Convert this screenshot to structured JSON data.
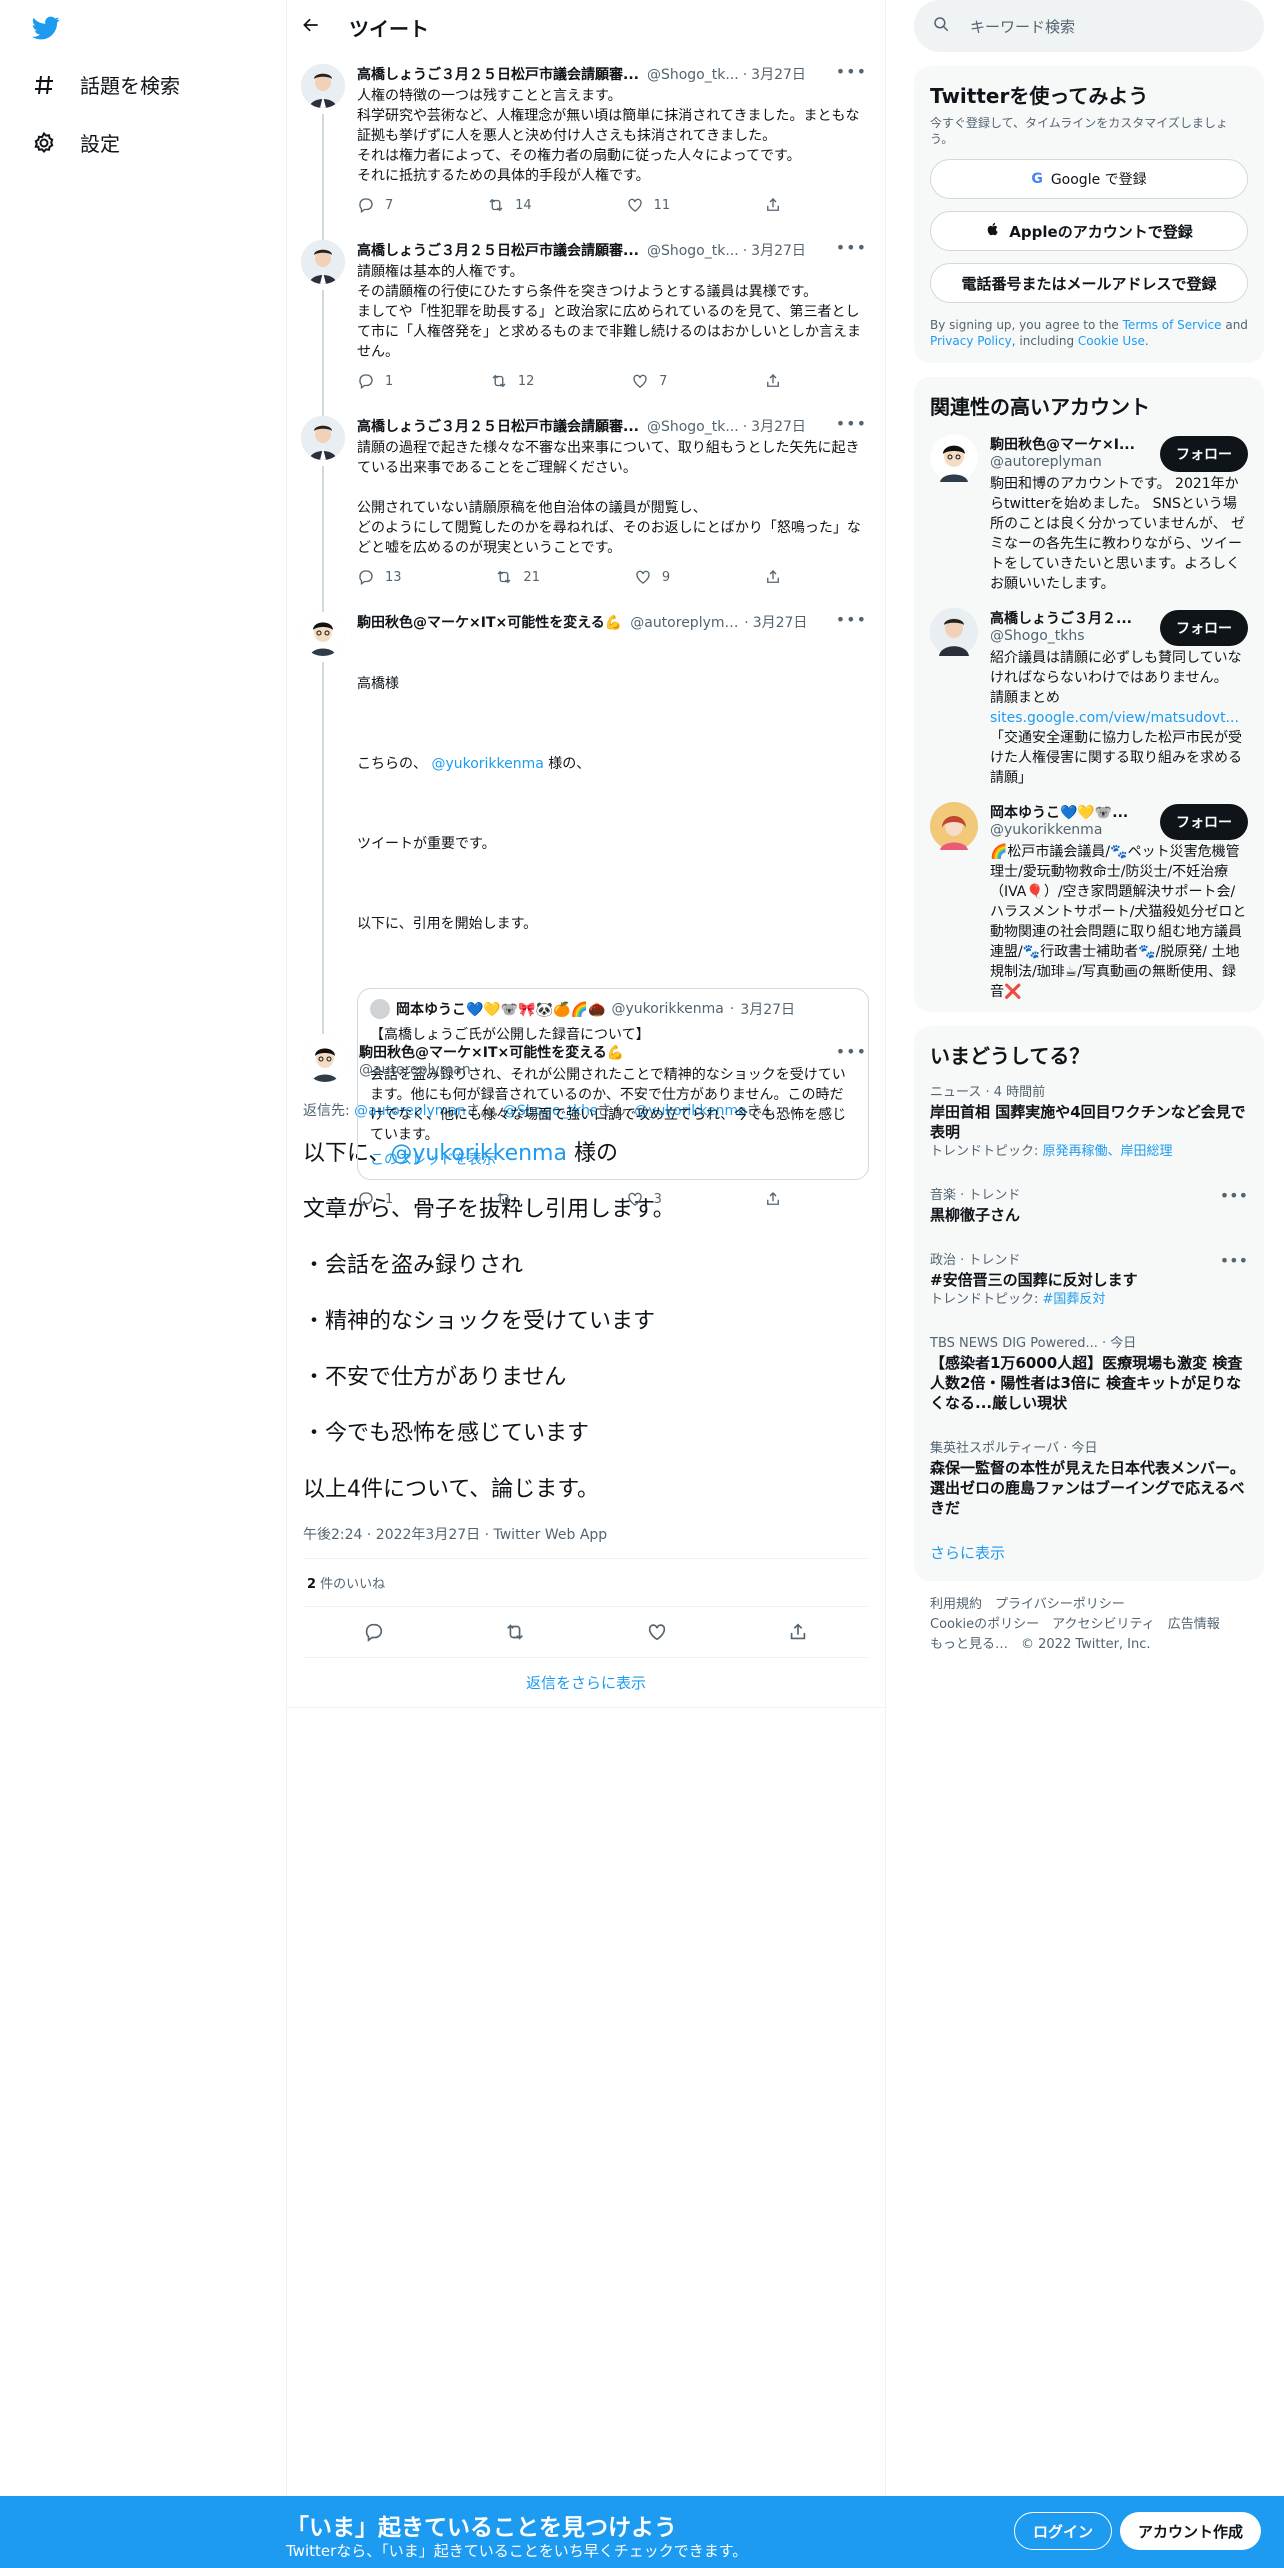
{
  "colors": {
    "brand": "#1d9bf0",
    "text": "#0f1419",
    "muted": "#536471"
  },
  "nav": {
    "logo": "twitter-bird-icon",
    "items": [
      {
        "label": "話題を検索",
        "icon": "hash-icon"
      },
      {
        "label": "設定",
        "icon": "gear-icon"
      }
    ]
  },
  "main": {
    "header_title": "ツイート",
    "tweets": [
      {
        "name": "高橋しょうご３月２５日松戸市議会請願審...",
        "handle": "@Shogo_tk...",
        "time": "3月27日",
        "text": "人権の特徴の一つは残すことと言えます。\n科学研究や芸術など、人権理念が無い頃は簡単に抹消されてきました。まともな証拠も挙げずに人を悪人と決め付け人さえも抹消されてきました。\nそれは権力者によって、その権力者の扇動に従った人々によってです。\nそれに抵抗するための具体的手段が人権です。",
        "replies": "7",
        "retweets": "14",
        "likes": "11"
      },
      {
        "name": "高橋しょうご３月２５日松戸市議会請願審...",
        "handle": "@Shogo_tk...",
        "time": "3月27日",
        "text": "請願権は基本的人権です。\nその請願権の行使にひたすら条件を突きつけようとする議員は異様です。\nましてや「性犯罪を助長する」と政治家に広められているのを見て、第三者として市に「人権啓発を」と求めるものまで非難し続けるのはおかしいとしか言えません。",
        "replies": "1",
        "retweets": "12",
        "likes": "7"
      },
      {
        "name": "高橋しょうご３月２５日松戸市議会請願審...",
        "handle": "@Shogo_tk...",
        "time": "3月27日",
        "text": "請願の過程で起きた様々な不審な出来事について、取り組もうとした矢先に起きている出来事であることをご理解ください。\n\n公開されていない請願原稿を他自治体の議員が閲覧し、\nどのようにして閲覧したのかを尋ねれば、そのお返しにとばかり「怒鳴った」などと嘘を広めるのが現実ということです。",
        "replies": "13",
        "retweets": "21",
        "likes": "9"
      }
    ],
    "quote_tweet": {
      "name": "駒田秋色@マーケ×IT×可能性を変える💪",
      "handle": "@autoreplyman",
      "time": "3月27日",
      "line1": "高橋様",
      "line2_pre": "こちらの、 ",
      "line2_link": "@yukorikkenma",
      "line2_post": " 様の、",
      "line3": "ツイートが重要です。",
      "line4": "以下に、引用を開始します。",
      "quoted": {
        "name": "岡本ゆうこ💙💛🐨🎀🐼🍊🌈🌰",
        "handle": "@yukorikkenma",
        "time": "3月27日",
        "text": "【高橋しょうご氏が公開した録音について】\n\n会話を盗み録りされ、それが公開されたことで精神的なショックを受けています。他にも何が録音されているのか、不安で仕方がありません。この時だけでなく、他にも様々な場面で強い口調で攻め立てられ、今でも恐怖を感じています。",
        "thread_link": "このスレッドを表示"
      },
      "replies": "1",
      "retweets": "",
      "likes": "3"
    },
    "focused": {
      "name": "駒田秋色@マーケ×IT×可能性を変える💪",
      "handle": "@autoreplyman",
      "reply_prefix": "返信先: ",
      "reply_users": [
        "@autoreplyman",
        "@Shogo_tkhs",
        "@yukorikkenma"
      ],
      "reply_suffix": "さん",
      "lines": [
        {
          "pre": "以下に、",
          "link": "@yukorikkenma",
          "post": " 様の"
        },
        {
          "pre": "文章から、骨子を抜粋し引用します。"
        },
        {
          "pre": "・会話を盗み録りされ"
        },
        {
          "pre": "・精神的なショックを受けています"
        },
        {
          "pre": "・不安で仕方がありません"
        },
        {
          "pre": "・今でも恐怖を感じています"
        },
        {
          "pre": "以上4件について、論じます。"
        }
      ],
      "meta": "午後2:24 · 2022年3月27日 · Twitter Web App",
      "like_count": "2",
      "like_label": " 件のいいね",
      "show_more": "返信をさらに表示"
    }
  },
  "right": {
    "search_placeholder": "キーワード検索",
    "signup_card": {
      "title": "Twitterを使ってみよう",
      "subtitle": "今すぐ登録して、タイムラインをカスタマイズしましょう。",
      "google": "Google で登録",
      "apple": "Appleのアカウントで登録",
      "phone": "電話番号またはメールアドレスで登録",
      "terms_pre": "By signing up, you agree to the ",
      "tos": "Terms of Service",
      "and": " and ",
      "privacy": "Privacy Policy",
      "including": ", including ",
      "cookie": "Cookie Use",
      "period": "."
    },
    "related": {
      "title": "関連性の高いアカウント",
      "follow_label": "フォロー",
      "accounts": [
        {
          "name": "駒田秋色@マーケ×I...",
          "handle": "@autoreplyman",
          "bio": "駒田和博のアカウントです。 2021年からtwitterを始めました。 SNSという場所のことは良く分かっていませんが、 ゼミなーの各先生に教わりながら、ツイートをしていきたいと思います。よろしくお願いいたします。"
        },
        {
          "name": "高橋しょうご３月２...",
          "handle": "@Shogo_tkhs",
          "bio_pre": "紹介議員は請願に必ずしも賛同していなければならないわけではありません。　　請願まとめ",
          "bio_link": "sites.google.com/view/matsudovt...",
          "bio_post": "「交通安全運動に協力した松戸市民が受けた人権侵害に関する取り組みを求める請願」"
        },
        {
          "name": "岡本ゆうこ💙💛🐨...",
          "handle": "@yukorikkenma",
          "bio": "🌈松戸市議会議員/🐾ペット災害危機管理士/愛玩動物救命士/防災士/不妊治療（IVA🎈）/空き家問題解決サポート会/ハラスメントサポート/犬猫殺処分ゼロと動物関連の社会問題に取り組む地方議員連盟/🐾行政書士補助者🐾/脱原発/ 土地規制法/珈琲☕/写真動画の無断使用、録音❌"
        }
      ]
    },
    "trends": {
      "title": "いまどうしてる？",
      "items": [
        {
          "meta": "ニュース · 4 時間前",
          "title": "岸田首相 国葬実施や4回目ワクチンなど会見で表明",
          "topic_label": "トレンドトピック: ",
          "topic": "原発再稼働、岸田総理",
          "more": false
        },
        {
          "meta": "音楽 · トレンド",
          "title": "黒柳徹子さん",
          "more": true
        },
        {
          "meta": "政治 · トレンド",
          "title": "#安倍晋三の国葬に反対します",
          "topic_label": "トレンドトピック: ",
          "topic": "#国葬反対",
          "more": true
        },
        {
          "meta": "TBS NEWS DIG Powered... · 今日",
          "title": "【感染者1万6000人超】医療現場も激変 検査人数2倍・陽性者は3倍に 検査キットが足りなくなる...厳しい現状",
          "more": false
        },
        {
          "meta": "集英社スポルティーバ · 今日",
          "title": "森保一監督の本性が見えた日本代表メンバー。選出ゼロの鹿島ファンはブーイングで応えるべきだ",
          "more": false
        }
      ],
      "show_more": "さらに表示"
    },
    "footer": {
      "line1": "利用規約　プライバシーポリシー",
      "line2": "Cookieのポリシー　アクセシビリティ　広告情報",
      "line3": "もっと見る…　© 2022 Twitter, Inc."
    }
  },
  "bottom": {
    "title": "「いま」起きていることを見つけよう",
    "subtitle": "Twitterなら、「いま」起きていることをいち早くチェックできます。",
    "login": "ログイン",
    "signup": "アカウント作成"
  }
}
